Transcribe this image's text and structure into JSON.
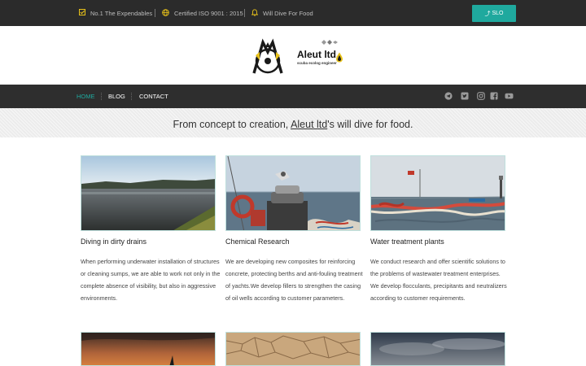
{
  "topbar": {
    "items": [
      {
        "icon": "check-square-icon",
        "label": "No.1 The Expendables"
      },
      {
        "icon": "globe-icon",
        "label": "Certified ISO 9001 : 2015"
      },
      {
        "icon": "bell-icon",
        "label": "Will Dive For Food"
      }
    ],
    "button_label": "SLO",
    "accent_color": "#1fa99e",
    "icon_color": "#e8c21a"
  },
  "logo": {
    "title": "Aleut ltd.",
    "subtitle": "scuba ecolog engineer"
  },
  "nav": {
    "items": [
      "HOME",
      "BLOG",
      "CONTACT"
    ],
    "active": "HOME",
    "social_icons": [
      "telegram-icon",
      "twitter-icon",
      "instagram-icon",
      "facebook-icon",
      "youtube-icon"
    ]
  },
  "tagline": {
    "before": "From concept to creation, ",
    "brand": "Aleut ltd",
    "after": "'s will dive for food."
  },
  "cards": [
    {
      "title": "Diving in dirty drains",
      "text": "When performing underwater installation of structures or cleaning sumps, we are able to work not only in the complete absence of visibility, but also in aggressive environments."
    },
    {
      "title": "Chemical Research",
      "text": "We are developing new composites for reinforcing concrete, protecting berths and anti-fouling treatment of yachts.We develop fillers to strengthen the casing of oil wells according to customer parameters."
    },
    {
      "title": "Water treatment plants",
      "text": "We conduct research and offer scientific solutions to the problems of wastewater treatment enterprises. We develop flocculants, precipitants and neutralizers according to customer requirements."
    }
  ]
}
